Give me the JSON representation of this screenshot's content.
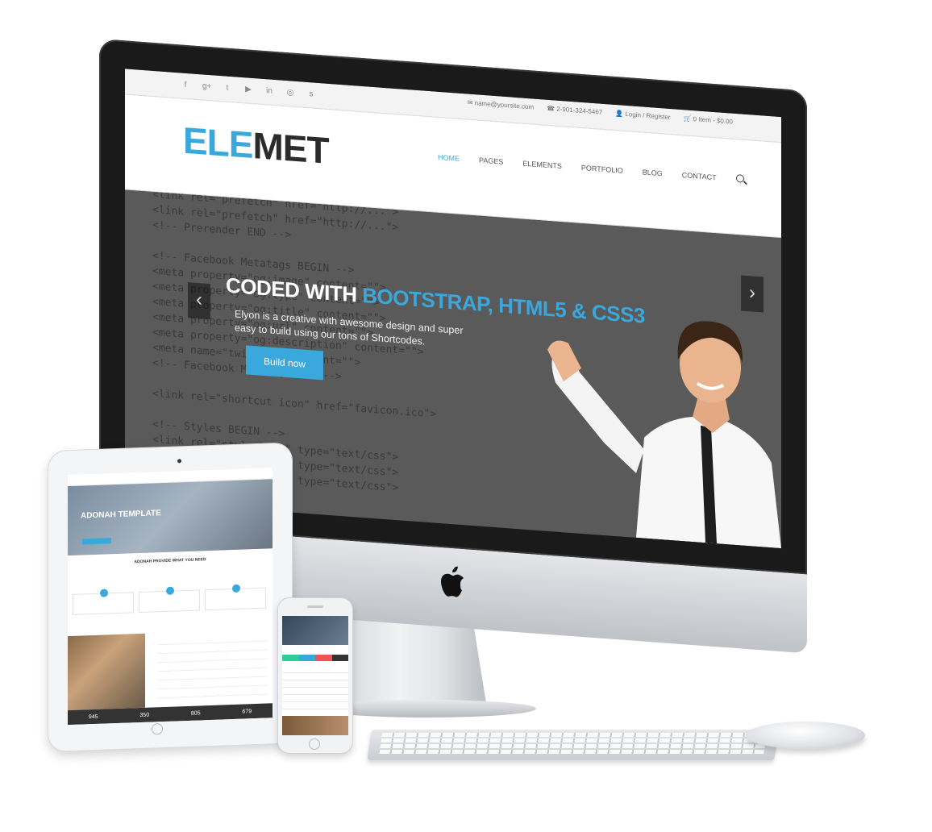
{
  "site": {
    "social_icons": [
      "facebook-icon",
      "google-plus-icon",
      "twitter-icon",
      "youtube-icon",
      "linkedin-icon",
      "dribbble-icon",
      "skype-icon"
    ],
    "social_glyphs": [
      "f",
      "g+",
      "t",
      "▶",
      "in",
      "◎",
      "s"
    ],
    "topbar": {
      "email": "name@yoursite.com",
      "phone": "2-901-324-5467",
      "login": "Login / Register",
      "cart": "0 Item - $0.00"
    },
    "logo": {
      "part1": "ELE",
      "part2": "MET"
    },
    "nav": {
      "items": [
        "HOME",
        "PAGES",
        "ELEMENTS",
        "PORTFOLIO",
        "BLOG",
        "CONTACT"
      ],
      "active": "HOME"
    },
    "hero": {
      "title_plain": "CODED WITH ",
      "title_highlight": "BOOTSTRAP, HTML5 & CSS3",
      "subtitle": "Elyon is a creative with awesome design and super easy to build using our tons of Shortcodes.",
      "button": "Build now",
      "prev": "‹",
      "next": "›"
    }
  },
  "tablet": {
    "hero_title": "ADONAH TEMPLATE",
    "heading": "ADONAH PROVIDE WHAT YOU NEED",
    "stats": [
      "945",
      "350",
      "805",
      "679"
    ]
  },
  "colors": {
    "accent": "#3aa8dc",
    "dark": "#2b2b2b",
    "overlay": "#5a5a5a"
  }
}
